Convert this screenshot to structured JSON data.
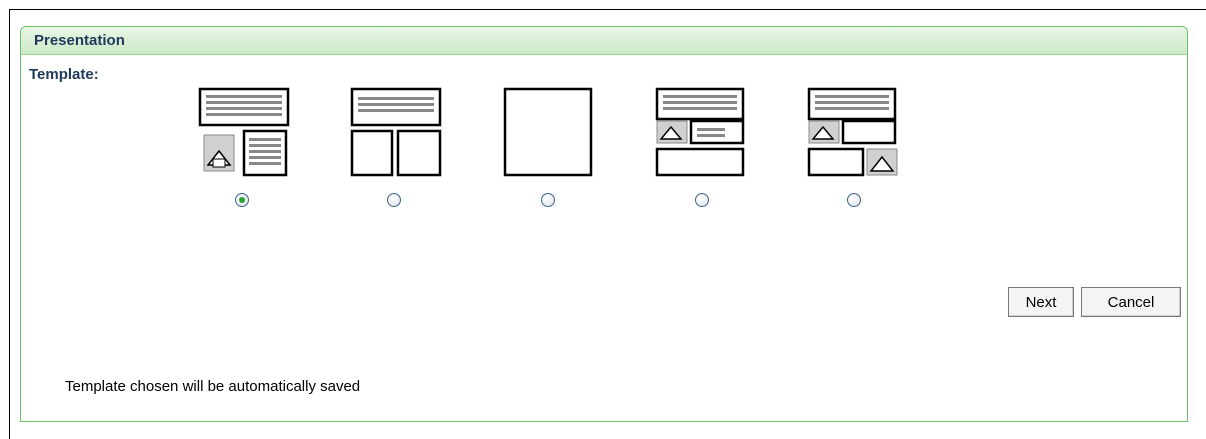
{
  "panel": {
    "title": "Presentation",
    "template_label": "Template:"
  },
  "templates": [
    {
      "name": "header-image-text",
      "selected": true
    },
    {
      "name": "header-two-columns",
      "selected": false
    },
    {
      "name": "single-block",
      "selected": false
    },
    {
      "name": "header-image-text-footer",
      "selected": false
    },
    {
      "name": "header-alternating-images",
      "selected": false
    }
  ],
  "buttons": {
    "next_label": "Next",
    "cancel_label": "Cancel"
  },
  "note": "Template chosen will be automatically saved",
  "colors": {
    "panel_border": "#6cc06c",
    "header_gradient_top": "#eaf7e6",
    "header_gradient_bottom": "#cde9c6",
    "title_color": "#1f3a5a",
    "radio_selected": "#2aa42a"
  }
}
